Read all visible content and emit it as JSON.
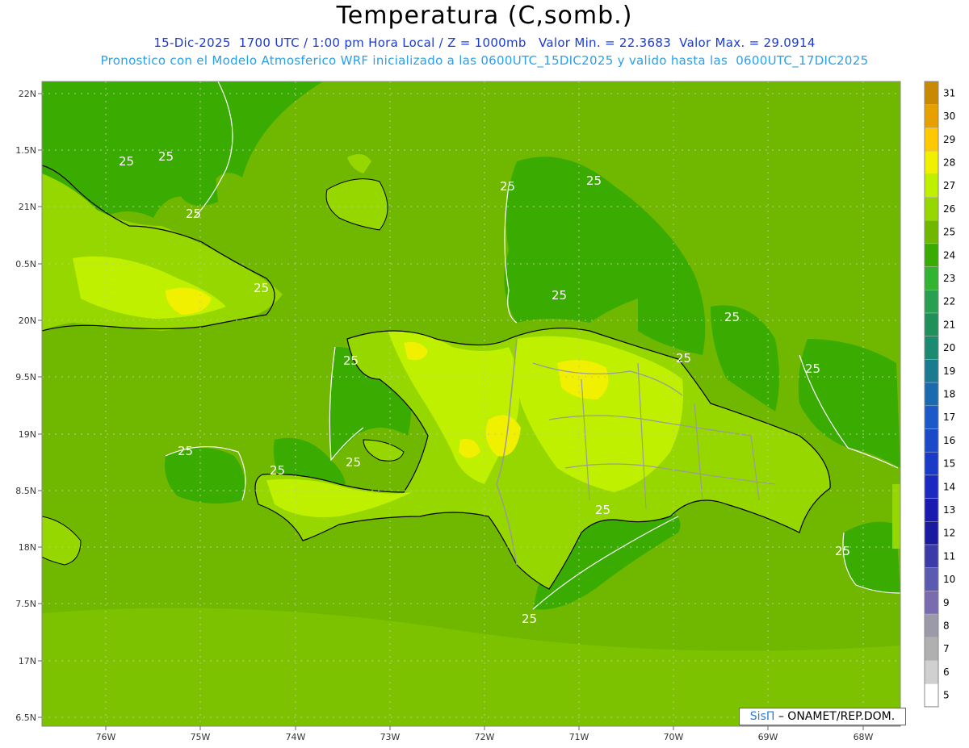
{
  "header": {
    "title": "Temperatura (C,somb.)",
    "line1": "15-Dic-2025  1700 UTC / 1:00 pm Hora Local / Z = 1000mb   Valor Min. = 22.3683  Valor Max. = 29.0914",
    "line2": "Pronostico con el Modelo Atmosferico WRF inicializado a las 0600UTC_15DIC2025 y valido hasta las  0600UTC_17DIC2025"
  },
  "axes": {
    "lon_labels": [
      "76W",
      "75W",
      "74W",
      "73W",
      "72W",
      "71W",
      "70W",
      "69W",
      "68W"
    ],
    "lat_labels": [
      "22N",
      "1.5N",
      "21N",
      "0.5N",
      "20N",
      "9.5N",
      "19N",
      "8.5N",
      "18N",
      "7.5N",
      "17N",
      "6.5N"
    ]
  },
  "legend": {
    "levels": [
      "31",
      "30",
      "29",
      "28",
      "27",
      "26",
      "25",
      "24",
      "23",
      "22",
      "21",
      "20",
      "19",
      "18",
      "17",
      "16",
      "15",
      "14",
      "13",
      "12",
      "11",
      "10",
      "9",
      "8",
      "7",
      "6",
      "5"
    ],
    "colors": [
      "#c88a00",
      "#e6a000",
      "#ffc800",
      "#f0f000",
      "#bef000",
      "#96d700",
      "#70b800",
      "#3aab00",
      "#32b432",
      "#28a050",
      "#20905a",
      "#1a8a70",
      "#1a7a90",
      "#1a6ab0",
      "#1a5ac8",
      "#1a4ac8",
      "#1a3ac8",
      "#1a2ac0",
      "#1a1ab0",
      "#1a1aa0",
      "#3a3aa8",
      "#5a5ab0",
      "#7a6ab0",
      "#9a9aa8",
      "#b0b0b0",
      "#d0d0d0",
      "#ffffff"
    ]
  },
  "contour_label": "25",
  "credit": {
    "brand": "SisΠ",
    "text": "– ONAMET/REP.DOM."
  }
}
